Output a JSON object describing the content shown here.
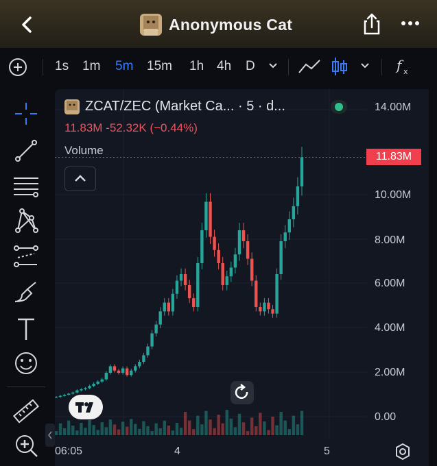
{
  "header": {
    "title": "Anonymous Cat",
    "back_icon": "chevron-left-icon",
    "share_icon": "share-icon",
    "more_icon": "more-dots-icon"
  },
  "toolbar": {
    "add_icon": "plus-circle-icon",
    "intervals": [
      "1s",
      "1m",
      "5m",
      "15m",
      "1h",
      "4h",
      "D"
    ],
    "active_interval": "5m",
    "line_icon": "line-chart-icon",
    "candle_icon": "candlestick-icon",
    "indicator_icon": "fx-icon"
  },
  "sidebar": {
    "tools": [
      "crosshair-icon",
      "trend-line-icon",
      "fib-lines-icon",
      "pattern-icon",
      "forecast-icon",
      "brush-icon",
      "text-icon",
      "emoji-icon",
      "ruler-icon",
      "zoom-in-icon"
    ]
  },
  "chart": {
    "symbol": "ZCAT/ZEC (Market Ca... · 5 · d...",
    "price_line": "11.83M  -52.32K (−0.44%)",
    "volume_label": "Volume",
    "last_price_tag": "11.83M",
    "colors": {
      "up": "#26a69a",
      "down": "#ef5350",
      "accent": "#3b7bf6",
      "tag": "#f0404d"
    }
  },
  "chart_data": {
    "type": "candlestick",
    "title": "ZCAT/ZEC (Market Ca... · 5 · d...",
    "y_ticks": [
      "14.00M",
      "10.00M",
      "8.00M",
      "6.00M",
      "4.00M",
      "2.00M",
      "0.00"
    ],
    "x_ticks": [
      "06:05",
      "4",
      "5"
    ],
    "ylim": [
      0,
      14000000
    ],
    "last_value": 11830000,
    "change": -52320,
    "change_percent": -0.44,
    "approx_close_series_millions": [
      0.9,
      0.95,
      1.0,
      1.05,
      1.1,
      1.2,
      1.25,
      1.3,
      1.4,
      1.5,
      1.6,
      1.7,
      2.0,
      2.3,
      2.1,
      2.0,
      2.2,
      1.9,
      2.1,
      2.3,
      2.5,
      2.8,
      3.2,
      3.8,
      4.2,
      4.8,
      5.2,
      4.8,
      5.6,
      6.2,
      6.5,
      6.0,
      5.4,
      5.0,
      7.0,
      8.5,
      9.8,
      8.2,
      7.6,
      7.0,
      6.0,
      6.4,
      6.8,
      7.4,
      8.5,
      8.0,
      7.2,
      6.2,
      5.0,
      4.8,
      5.2,
      4.9,
      4.7,
      6.5,
      8.0,
      8.4,
      9.0,
      9.6,
      10.5,
      11.83
    ]
  }
}
